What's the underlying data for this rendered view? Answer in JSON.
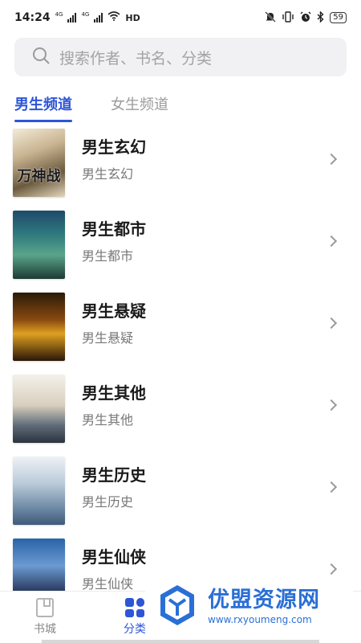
{
  "status_bar": {
    "time": "14:24",
    "network_1": "4G",
    "network_2": "4G",
    "hd": "HD",
    "battery": "59"
  },
  "search": {
    "placeholder": "搜索作者、书名、分类"
  },
  "tabs": [
    {
      "label": "男生频道",
      "active": true
    },
    {
      "label": "女生频道",
      "active": false
    }
  ],
  "categories": [
    {
      "title": "男生玄幻",
      "subtitle": "男生玄幻",
      "cover_text": "万神战"
    },
    {
      "title": "男生都市",
      "subtitle": "男生都市",
      "cover_text": ""
    },
    {
      "title": "男生悬疑",
      "subtitle": "男生悬疑",
      "cover_text": ""
    },
    {
      "title": "男生其他",
      "subtitle": "男生其他",
      "cover_text": ""
    },
    {
      "title": "男生历史",
      "subtitle": "男生历史",
      "cover_text": ""
    },
    {
      "title": "男生仙侠",
      "subtitle": "男生仙侠",
      "cover_text": ""
    }
  ],
  "bottom_nav": [
    {
      "label": "书城",
      "active": false
    },
    {
      "label": "分类",
      "active": true
    }
  ],
  "watermark": {
    "brand": "优盟资源网",
    "url": "www.rxyoumeng.com"
  },
  "colors": {
    "accent": "#2d55d6",
    "watermark": "#2a6fd6"
  }
}
